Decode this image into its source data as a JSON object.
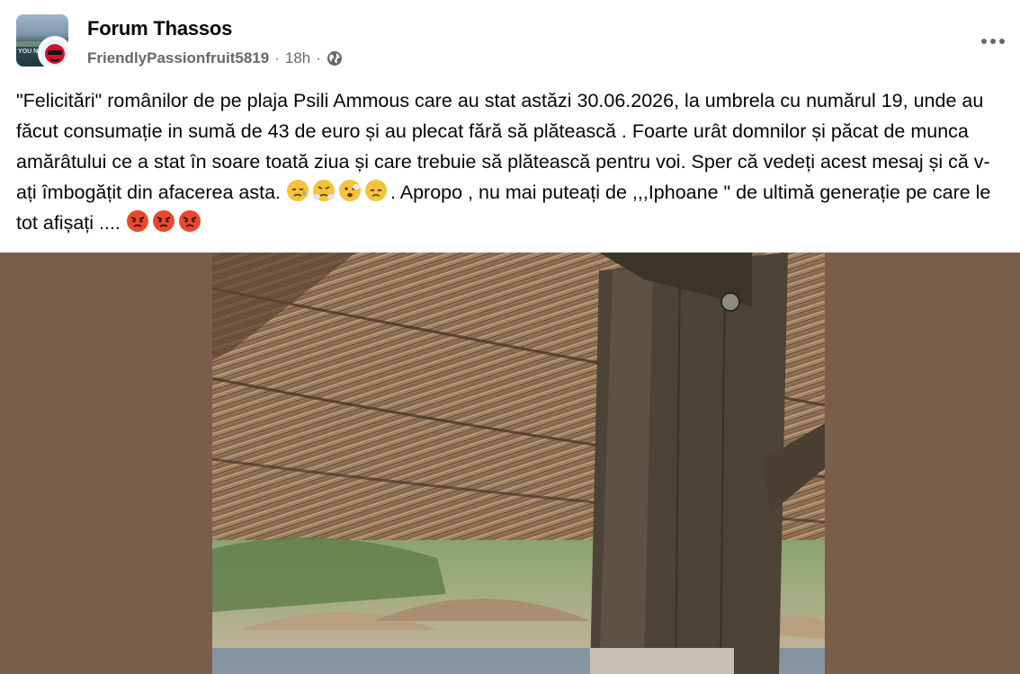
{
  "group": {
    "name": "Forum Thassos",
    "thumb_text": "YOU N"
  },
  "post": {
    "author": "FriendlyPassionfruit5819",
    "time": "18h",
    "privacy_icon": "globe-icon",
    "more_icon": "more-horizontal-icon",
    "text_before_emojis": "\"Felicitări\" românilor de pe plaja Psili Ammous care au stat astăzi 30.06.2026,  la umbrela cu numărul 19, unde au făcut consumație in sumă de 43 de euro și  au plecat fără să plătească .  Foarte urât domnilor și păcat de munca amărâtului ce a stat în soare toată ziua și care trebuie să plătească pentru voi. Sper că vedeți acest mesaj și că v-ați îmbogățit din afacerea asta. ",
    "emojis_1": [
      "sad-tear-emoji",
      "steam-nose-emoji",
      "worried-emoji",
      "disappointed-emoji"
    ],
    "text_middle": ". Apropo , nu mai puteați de ,,,Iphoane \" de ultimă generație pe care le tot afișați .... ",
    "emojis_2": [
      "angry-face-emoji",
      "angry-face-emoji",
      "angry-face-emoji"
    ]
  },
  "photo": {
    "subject": "thatched-umbrella-photo",
    "bg_color": "#7a5e4b"
  },
  "colors": {
    "text": "#050505",
    "meta": "#65676b",
    "emoji_yellow": "#f5c33b",
    "emoji_angry": "#e8492c"
  }
}
